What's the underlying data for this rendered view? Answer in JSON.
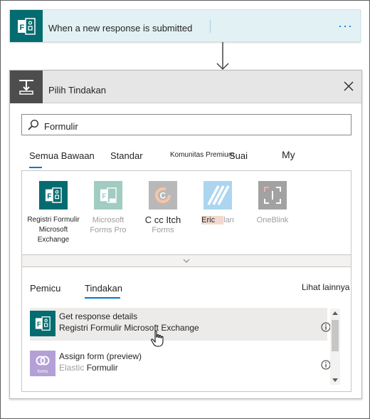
{
  "trigger": {
    "title": "When a new response is submitted",
    "more_label": "···",
    "icon": "microsoft-forms-icon",
    "accent": "#036c70"
  },
  "action_card": {
    "title": "Pilih Tindakan",
    "icon": "choose-operation-icon",
    "close_icon": "close-icon"
  },
  "search": {
    "value": "Formulir",
    "icon": "search-icon"
  },
  "tabs": [
    {
      "label": "Semua Bawaan",
      "active": true
    },
    {
      "label": "Standar"
    },
    {
      "label": "Komunitas Premium"
    },
    {
      "label": "Suai"
    },
    {
      "label": "My"
    }
  ],
  "connectors": [
    {
      "label_line1": "Registri Formulir",
      "label_line2": "Microsoft Exchange",
      "icon": "microsoft-forms-icon",
      "color": "#036c70"
    },
    {
      "label_line1": "Microsoft",
      "label_line2": "Forms Pro",
      "icon": "microsoft-forms-pro-icon",
      "color": "#2f8f7a"
    },
    {
      "label_line1": "C cc Itch",
      "label_line2": "Forms",
      "icon": "cognito-forms-icon",
      "color": "#636363"
    },
    {
      "label_line1": "Eric",
      "label_line2": "lan",
      "icon": "striped-icon",
      "color": "#4aa3df"
    },
    {
      "label_line1": "OneBlink",
      "icon": "oneblink-icon",
      "color": "#333333"
    }
  ],
  "expand_icon": "chevron-down-icon",
  "subtabs": [
    {
      "label": "Pemicu"
    },
    {
      "label": "Tindakan",
      "active": true
    }
  ],
  "see_more": "Lihat lainnya",
  "actions": [
    {
      "title": "Get response details",
      "subtitle": "Registri Formulir Microsoft Exchange",
      "icon": "microsoft-forms-icon",
      "color": "#036c70"
    },
    {
      "title": "Assign form (preview)",
      "subtitle_muted": "Elastic",
      "subtitle": "Formulir",
      "icon": "forms-icon",
      "icon_text": "forms",
      "color": "#b4a0d6"
    }
  ]
}
